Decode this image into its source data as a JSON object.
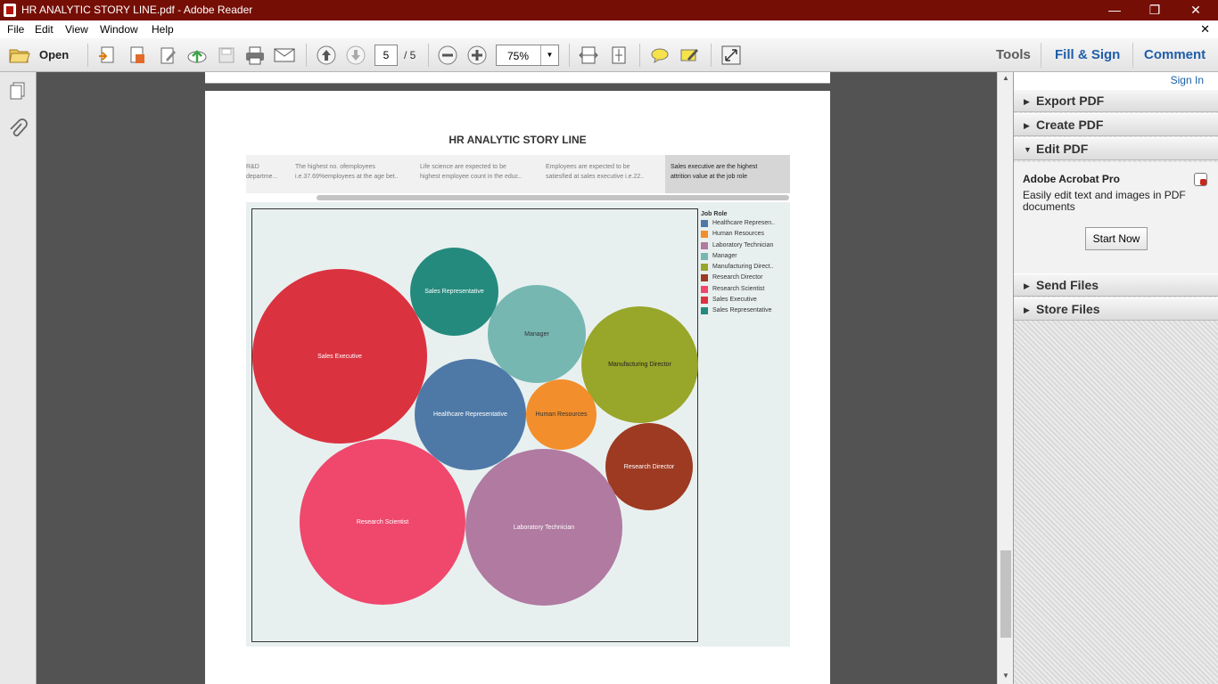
{
  "window": {
    "title": "HR ANALYTIC STORY LINE.pdf - Adobe Reader"
  },
  "menu": [
    "File",
    "Edit",
    "View",
    "Window",
    "Help"
  ],
  "toolbar": {
    "open_label": "Open",
    "page_current": "5",
    "page_total": "/ 5",
    "zoom": "75%",
    "tools": "Tools",
    "fill_sign": "Fill & Sign",
    "comment": "Comment"
  },
  "right_panel": {
    "sign_in": "Sign In",
    "sections_top": [
      "Export PDF",
      "Create PDF",
      "Edit PDF"
    ],
    "sections_bottom": [
      "Send Files",
      "Store Files"
    ],
    "promo": {
      "title": "Adobe Acrobat Pro",
      "description": "Easily edit text and images in PDF documents",
      "button": "Start Now"
    }
  },
  "story": {
    "title": "HR ANALYTIC STORY LINE",
    "captions": [
      {
        "line1": "R&D",
        "line2": "departme..."
      },
      {
        "line1": "The highest no. ofemployees",
        "line2": "i.e.37.69%employees at the age bet.."
      },
      {
        "line1": "Life science are expected to be",
        "line2": "highest employee count in the educ.."
      },
      {
        "line1": "Employees are expected to be",
        "line2": "satiesfied at  sales executive  i.e.22.."
      },
      {
        "line1": "Sales executive are the highest",
        "line2": "attrition value at the job role"
      }
    ]
  },
  "chart_data": {
    "type": "bubble",
    "legend_title": "Job Role",
    "legend_placement": "right",
    "items": [
      {
        "name": "Healthcare Representative",
        "legend_label": "Healthcare Represen..",
        "color": "#4e79a7",
        "relative_size": 1.0
      },
      {
        "name": "Human Resources",
        "legend_label": "Human Resources",
        "color": "#f28e2b",
        "relative_size": 0.41
      },
      {
        "name": "Laboratory Technician",
        "legend_label": "Laboratory Technician",
        "color": "#b07aa1",
        "relative_size": 1.96
      },
      {
        "name": "Manager",
        "legend_label": "Manager",
        "color": "#76b7b2",
        "relative_size": 0.79
      },
      {
        "name": "Manufacturing Director",
        "legend_label": "Manufacturing Direct..",
        "color": "#98a629",
        "relative_size": 1.09
      },
      {
        "name": "Research Director",
        "legend_label": "Research Director",
        "color": "#9e3a22",
        "relative_size": 0.62
      },
      {
        "name": "Research Scientist",
        "legend_label": "Research Scientist",
        "color": "#f0476d",
        "relative_size": 2.25
      },
      {
        "name": "Sales Executive",
        "legend_label": "Sales Executive",
        "color": "#db3240",
        "relative_size": 2.49
      },
      {
        "name": "Sales Representative",
        "legend_label": "Sales Representative",
        "color": "#248a7d",
        "relative_size": 0.64
      }
    ]
  }
}
